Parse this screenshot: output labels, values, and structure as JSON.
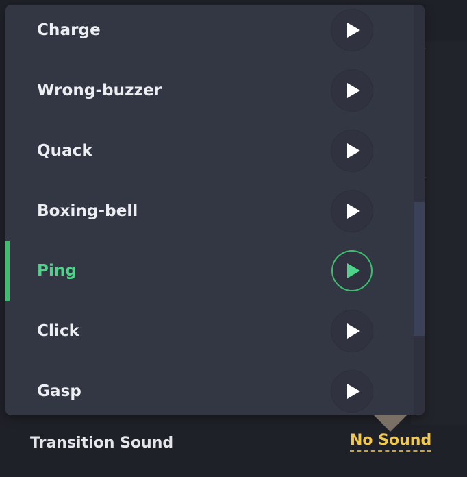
{
  "sounds": {
    "items": [
      {
        "label": "Charge",
        "selected": false
      },
      {
        "label": "Wrong-buzzer",
        "selected": false
      },
      {
        "label": "Quack",
        "selected": false
      },
      {
        "label": "Boxing-bell",
        "selected": false
      },
      {
        "label": "Ping",
        "selected": true
      },
      {
        "label": "Click",
        "selected": false
      },
      {
        "label": "Gasp",
        "selected": false
      }
    ],
    "play_icon": "play-icon"
  },
  "footer": {
    "transition_label": "Transition Sound",
    "current_value": "No Sound"
  },
  "colors": {
    "background": "#1f2128",
    "dropdown": "#333643",
    "selected_accent": "#3dbd6e",
    "selected_text": "#4fd38a",
    "value_text": "#f2c94c"
  }
}
